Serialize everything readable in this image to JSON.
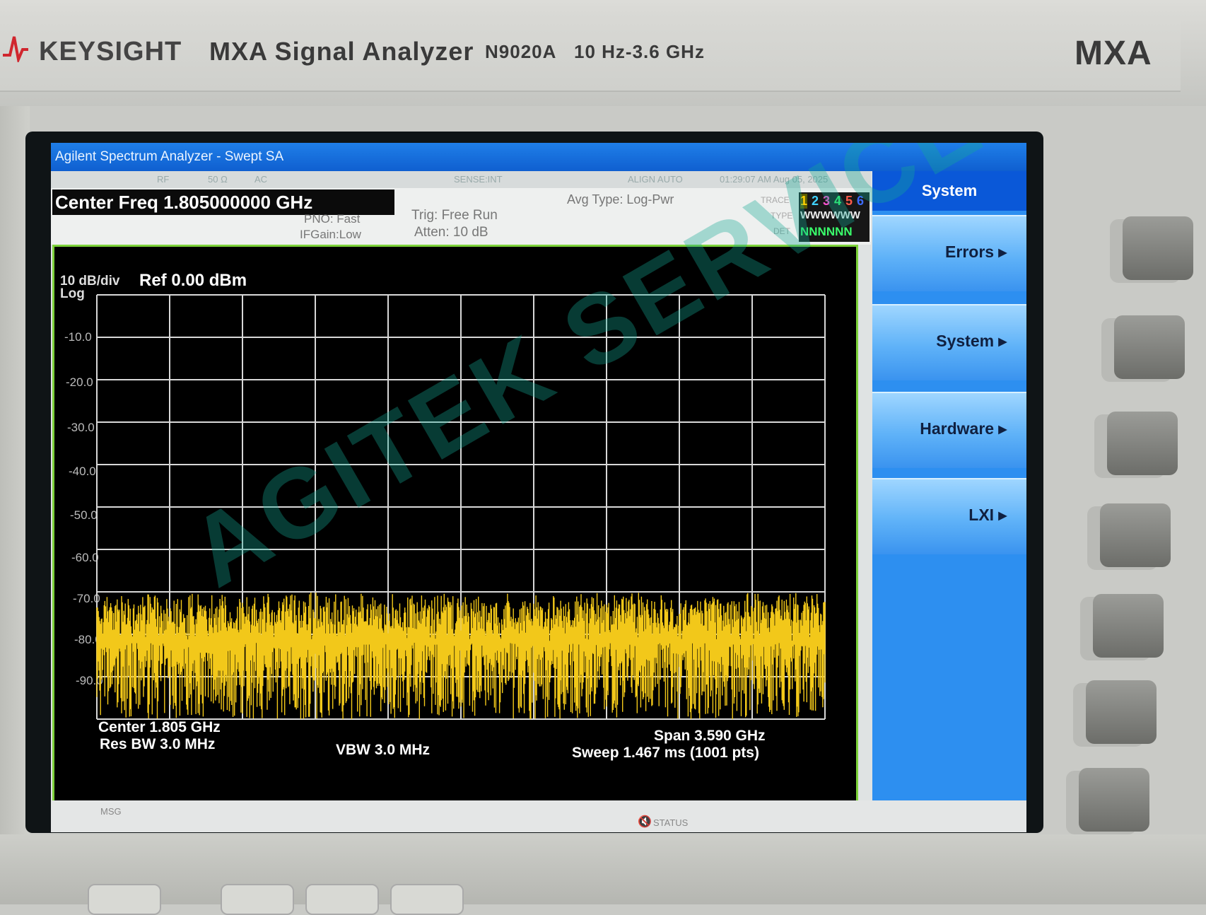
{
  "instrument": {
    "brand": "KEYSIGHT",
    "title": "MXA Signal Analyzer",
    "model": "N9020A",
    "range": "10 Hz-3.6 GHz",
    "badge": "MXA"
  },
  "window": {
    "title": "Agilent Spectrum Analyzer - Swept SA"
  },
  "status": {
    "rf": "RF",
    "impedance": "50 Ω",
    "coupling": "AC",
    "sense": "SENSE:INT",
    "align": "ALIGN AUTO",
    "datetime": "01:29:07 AM Aug 05, 2025"
  },
  "settings": {
    "center_freq": "Center Freq 1.805000000 GHz",
    "pno": "PNO: Fast",
    "ifgain": "IFGain:Low",
    "trig": "Trig: Free Run",
    "atten": "Atten: 10 dB",
    "avg_type": "Avg Type: Log-Pwr",
    "trace_label": "TRACE",
    "type_label": "TYPE",
    "det_label": "DET",
    "trace_numbers": [
      "1",
      "2",
      "3",
      "4",
      "5",
      "6"
    ],
    "trace_type": "WWWWWW",
    "trace_det": "NNNNNN"
  },
  "plot": {
    "scale": "10 dB/div",
    "scale_type": "Log",
    "ref": "Ref 0.00 dBm",
    "center": "Center 1.805 GHz",
    "res_bw": "Res BW 3.0 MHz",
    "vbw": "VBW 3.0 MHz",
    "span": "Span 3.590 GHz",
    "sweep": "Sweep  1.467 ms (1001 pts)",
    "trace_color": "#f2c81a",
    "grid_color": "#d8d8d8"
  },
  "chart_data": {
    "type": "line",
    "x": {
      "start_ghz": 0.01,
      "stop_ghz": 3.6,
      "points": 1001
    },
    "ylim": [
      -100,
      0
    ],
    "yticks": [
      "-10.0",
      "-20.0",
      "-30.0",
      "-40.0",
      "-50.0",
      "-60.0",
      "-70.0",
      "-80.0",
      "-90.0"
    ],
    "noise_floor_dbm": [
      -100,
      -70
    ],
    "xlabel": "",
    "ylabel": "",
    "grid": true
  },
  "softkeys": {
    "header": "System",
    "items": [
      "Errors ▸",
      "System ▸",
      "Hardware ▸",
      "LXI ▸"
    ]
  },
  "message_bar": {
    "msg_label": "MSG",
    "status_label": "STATUS"
  },
  "watermark": "AGITEK SERVICE"
}
